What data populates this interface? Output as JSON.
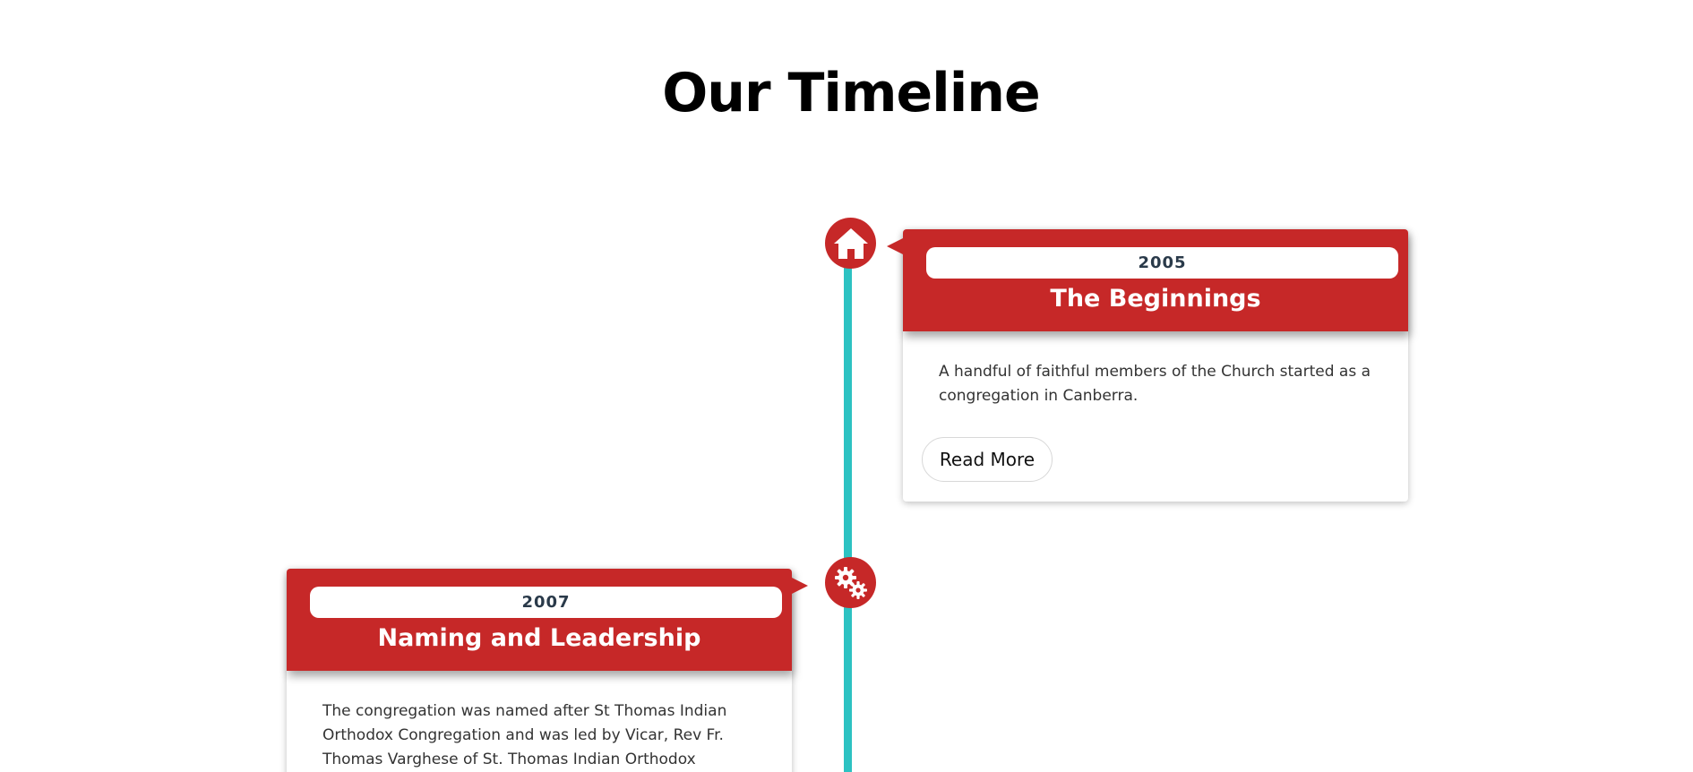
{
  "page": {
    "title": "Our Timeline"
  },
  "colors": {
    "accent": "#c62828",
    "timeline_line": "#2cc2c2",
    "text": "#333333"
  },
  "timeline": {
    "events": [
      {
        "year": "2005",
        "title": "The Beginnings",
        "description": "A handful of faithful members of the Church started as a congregation in Canberra.",
        "button_label": "Read More",
        "icon": "home-icon"
      },
      {
        "year": "2007",
        "title": "Naming and Leadership",
        "description": "The congregation was named after St Thomas Indian Orthodox Congregation and was led by Vicar, Rev Fr. Thomas Varghese of St. Thomas Indian Orthodox",
        "icon": "gears-icon"
      }
    ]
  }
}
